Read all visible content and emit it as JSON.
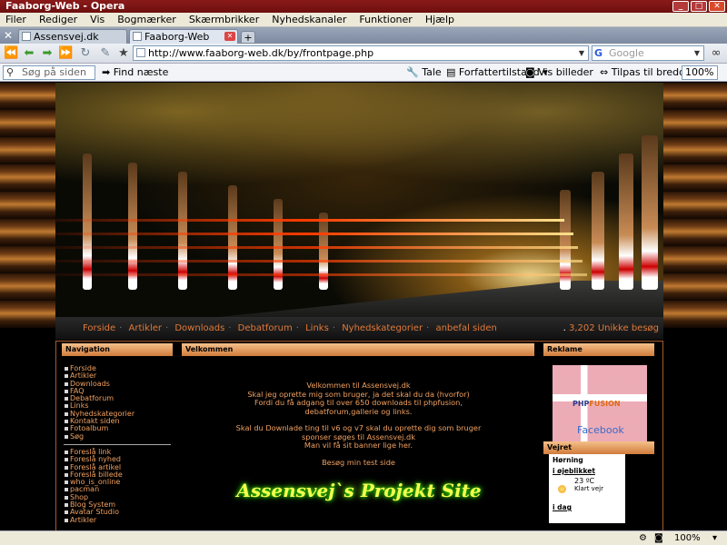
{
  "window": {
    "title": "Faaborg-Web - Opera",
    "buttons": {
      "minimize": "_",
      "maximize": "□",
      "close": "✕"
    }
  },
  "menu": [
    "Filer",
    "Rediger",
    "Vis",
    "Bogmærker",
    "Skærmbrikker",
    "Nyhedskanaler",
    "Funktioner",
    "Hjælp"
  ],
  "tabs": [
    {
      "label": "Assensvej.dk",
      "active": false
    },
    {
      "label": "Faaborg-Web",
      "active": true
    }
  ],
  "toolbar": {
    "url": "http://www.faaborg-web.dk/by/frontpage.php",
    "search_placeholder": "Google"
  },
  "findbar": {
    "placeholder": "Søg på siden",
    "find_next": "Find næste",
    "speak": "Tale",
    "author_mode": "Forfattertilstand",
    "show_images": "Vis billeder",
    "fit_width": "Tilpas til bredden",
    "zoom": "100%"
  },
  "site": {
    "nav_links": [
      "Forside",
      "Artikler",
      "Downloads",
      "Debatforum",
      "Links",
      "Nyhedskategorier",
      "anbefal siden"
    ],
    "visits": "3,202 Unikke besøg",
    "navigation": {
      "heading": "Navigation",
      "items": [
        "Forside",
        "Artikler",
        "Downloads",
        "FAQ",
        "Debatforum",
        "Links",
        "Nyhedskategorier",
        "Kontakt siden",
        "Fotoalbum",
        "Søg"
      ],
      "items2": [
        "Foreslå link",
        "Foreslå nyhed",
        "Foreslå artikel",
        "Foreslå billede",
        "who_is_online",
        "pacman",
        "Shop",
        "",
        "Blog System",
        "Avatar Studio",
        "Artikler"
      ]
    },
    "welcome": {
      "heading": "Velkommen",
      "lines1": [
        "Velkommen til Assensvej.dk",
        "Skal jeg oprette mig som bruger, ja det skal du da (hvorfor)",
        "Fordi du få adgang til over 650 downloads til phpfusion,",
        "debatforum,gallerie og links."
      ],
      "lines2": [
        "Skal du Downlade ting til v6 og v7 skal du oprette dig som bruger",
        "sponser søges til Assensvej.dk",
        "Man vil få sit banner lige her."
      ],
      "line3": "Besøg min test side",
      "project_title": "Assensvej`s Projekt Site"
    },
    "ads": {
      "heading": "Reklame",
      "logo_php": "PHP",
      "logo_fusion": "FUSION",
      "facebook": "Facebook"
    },
    "weather": {
      "heading": "Vejret",
      "city": "Hørning",
      "now_label": "i øjeblikket",
      "temp": "23 ºC",
      "condition": "Klart vejr",
      "today_label": "i dag"
    }
  },
  "status": {
    "zoom": "100%"
  }
}
